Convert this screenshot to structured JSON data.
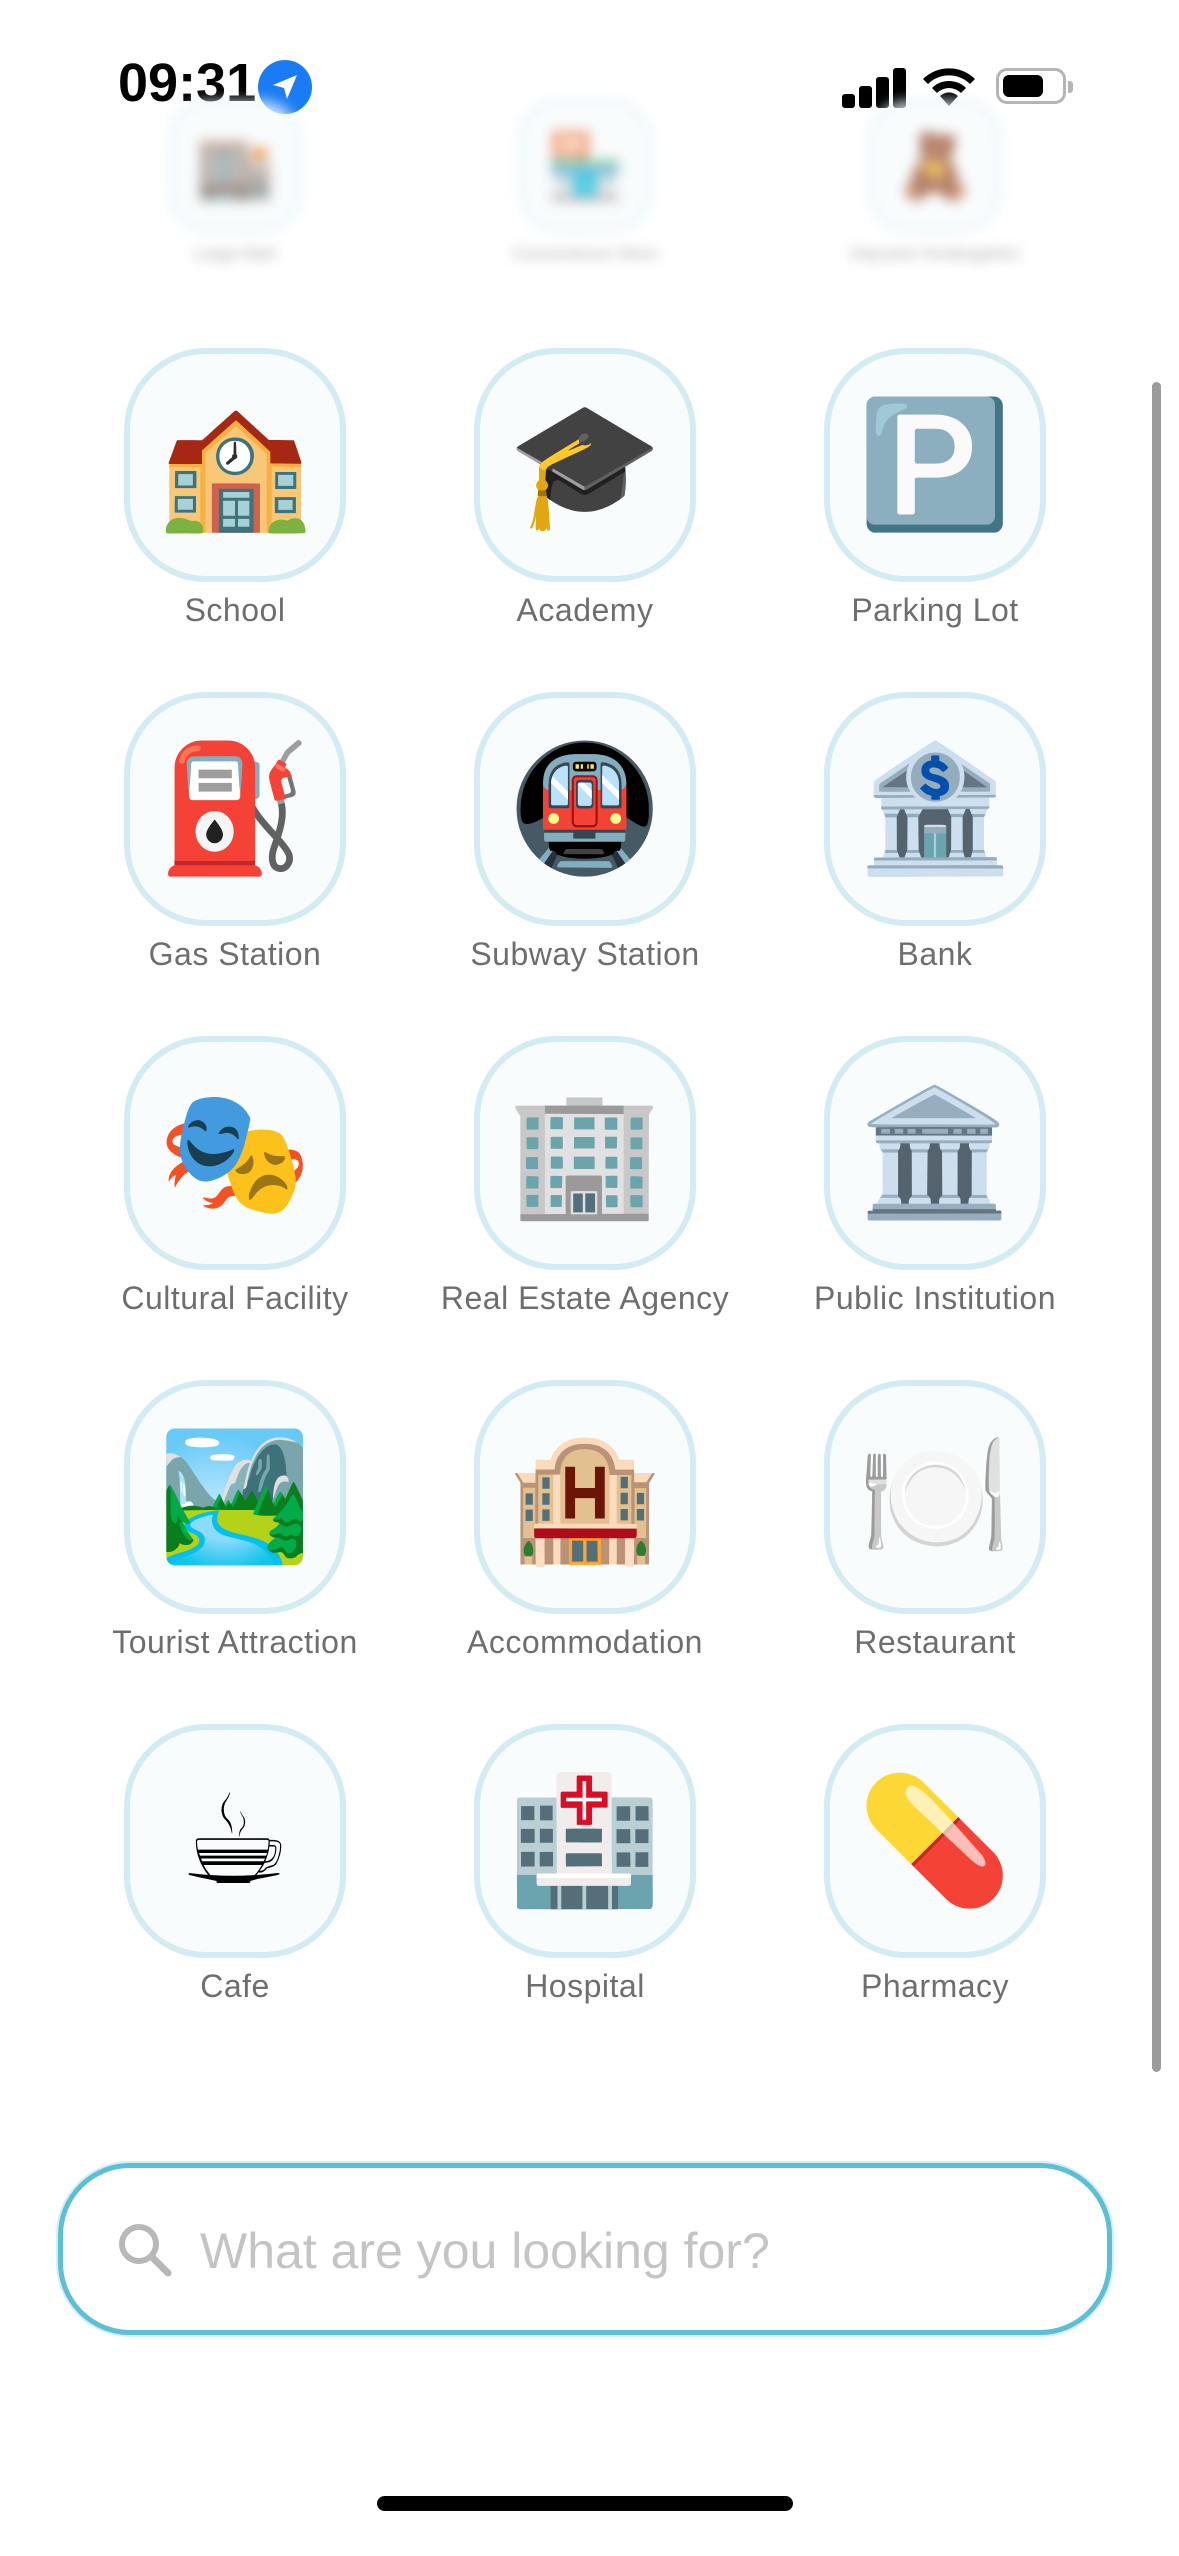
{
  "status_bar": {
    "time": "09:31",
    "icons": [
      "location-arrow-icon",
      "signal-icon",
      "wifi-icon",
      "battery-icon"
    ]
  },
  "top_row": [
    {
      "label": "Large Mart",
      "icon": "🏬"
    },
    {
      "label": "Convenience Store",
      "icon": "🏪"
    },
    {
      "label": "Daycare/ Kindergarten",
      "icon": "🧸"
    }
  ],
  "categories": [
    {
      "label": "School",
      "icon": "🏫",
      "id": "school"
    },
    {
      "label": "Academy",
      "icon": "🎓",
      "id": "academy"
    },
    {
      "label": "Parking Lot",
      "icon": "🅿️",
      "id": "parking-lot"
    },
    {
      "label": "Gas Station",
      "icon": "⛽",
      "id": "gas-station"
    },
    {
      "label": "Subway Station",
      "icon": "🚇",
      "id": "subway-station"
    },
    {
      "label": "Bank",
      "icon": "🏦",
      "id": "bank"
    },
    {
      "label": "Cultural Facility",
      "icon": "🎭",
      "id": "cultural-facility"
    },
    {
      "label": "Real Estate Agency",
      "icon": "🏢",
      "id": "real-estate-agency"
    },
    {
      "label": "Public Institution",
      "icon": "🏛️",
      "id": "public-institution"
    },
    {
      "label": "Tourist Attraction",
      "icon": "🏞️",
      "id": "tourist-attraction"
    },
    {
      "label": "Accommodation",
      "icon": "🏨",
      "id": "accommodation"
    },
    {
      "label": "Restaurant",
      "icon": "🍽️",
      "id": "restaurant"
    },
    {
      "label": "Cafe",
      "icon": "☕",
      "id": "cafe"
    },
    {
      "label": "Hospital",
      "icon": "🏥",
      "id": "hospital"
    },
    {
      "label": "Pharmacy",
      "icon": "💊",
      "id": "pharmacy"
    }
  ],
  "search": {
    "placeholder": "What are you looking for?",
    "value": "",
    "icon": "search-icon"
  },
  "colors": {
    "tile_border": "#d3ebf2",
    "search_border": "#5bbfd6",
    "label": "#6e6e6e",
    "location_badge": "#1a7cf5"
  }
}
